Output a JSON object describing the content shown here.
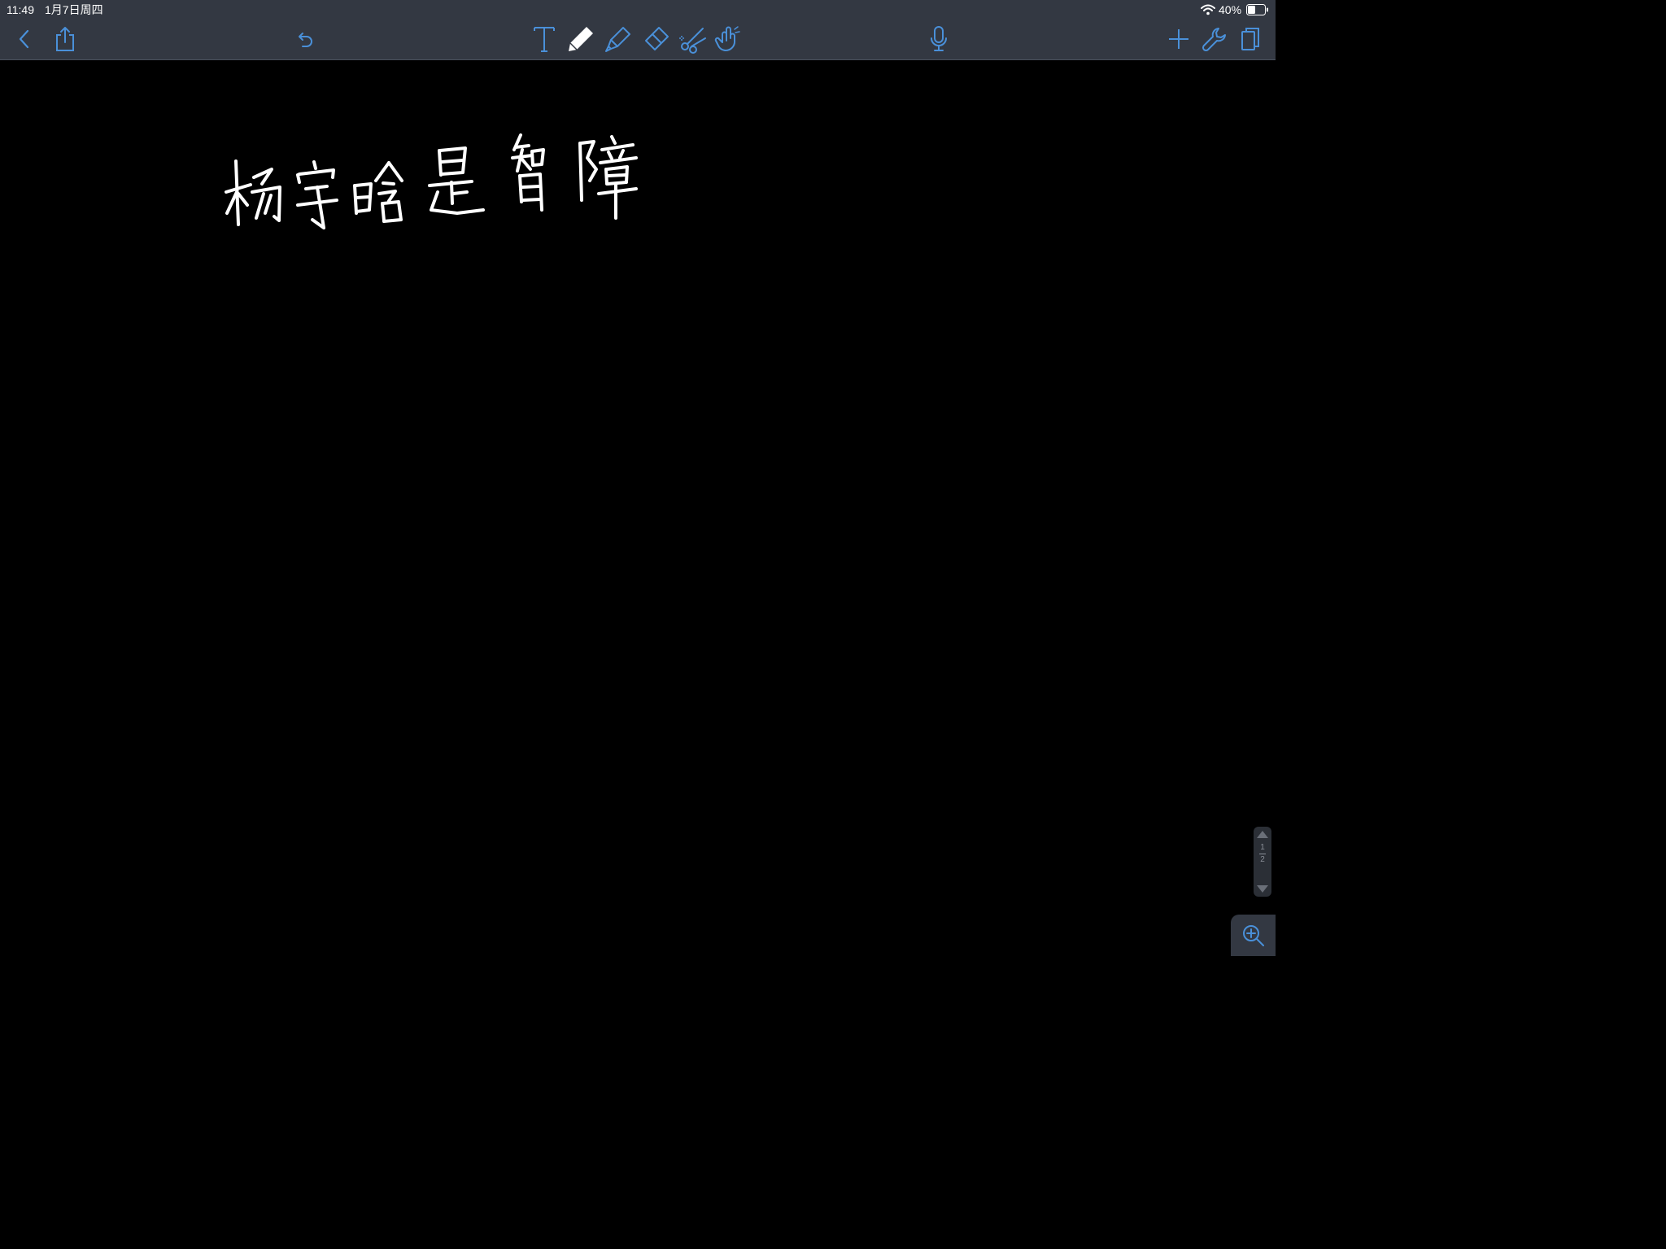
{
  "status_bar": {
    "time": "11:49",
    "date": "1月7日周四",
    "battery": "40%"
  },
  "toolbar": {
    "left": [
      "back-icon",
      "share-icon",
      "undo-icon"
    ],
    "center": [
      "text-tool-icon",
      "pen-tool-icon",
      "highlighter-tool-icon",
      "eraser-tool-icon",
      "scissors-tool-icon",
      "hand-tool-icon"
    ],
    "right": [
      "microphone-icon",
      "add-icon",
      "wrench-icon",
      "pages-icon"
    ],
    "accent_color": "#4a90d9",
    "active_tool": "pen-tool-icon"
  },
  "canvas": {
    "background": "#000000",
    "ink_color": "#ffffff",
    "handwritten_text": "杨宇晗是智障"
  },
  "page_navigator": {
    "current_page": "1",
    "total_pages": "2"
  },
  "zoom": {
    "icon": "zoom-in-icon"
  }
}
